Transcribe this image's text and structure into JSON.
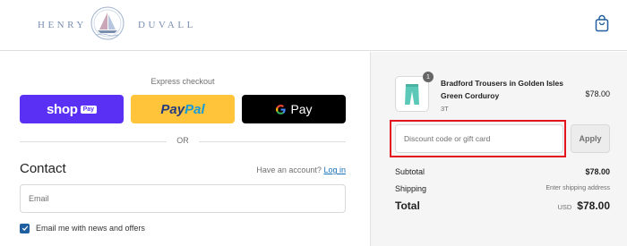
{
  "header": {
    "brand_left": "HENRY",
    "brand_right": "DUVALL"
  },
  "checkout": {
    "express_label": "Express checkout",
    "shop_label": "shop",
    "shop_badge": "Pay",
    "paypal_part1": "Pay",
    "paypal_part2": "Pal",
    "gpay_label": "Pay",
    "or_label": "OR",
    "contact_title": "Contact",
    "have_account": "Have an account?",
    "login_label": "Log in",
    "email_placeholder": "Email",
    "newsletter_label": "Email me with news and offers",
    "newsletter_checked": true
  },
  "summary": {
    "product": {
      "quantity": "1",
      "name": "Bradford Trousers in Golden Isles Green Corduroy",
      "variant": "3T",
      "price": "$78.00"
    },
    "discount_placeholder": "Discount code or gift card",
    "apply_label": "Apply",
    "subtotal_label": "Subtotal",
    "subtotal_value": "$78.00",
    "shipping_label": "Shipping",
    "shipping_value": "Enter shipping address",
    "total_label": "Total",
    "total_currency": "USD",
    "total_value": "$78.00"
  },
  "colors": {
    "shop_pay": "#5a31f4",
    "paypal": "#ffc439",
    "gpay": "#000000",
    "highlight": "#e3141b",
    "checkbox": "#1f5f9f"
  },
  "icons": [
    "sailboat-logo-icon",
    "shopping-bag-icon",
    "google-g-icon",
    "checkmark-icon",
    "trousers-icon"
  ]
}
